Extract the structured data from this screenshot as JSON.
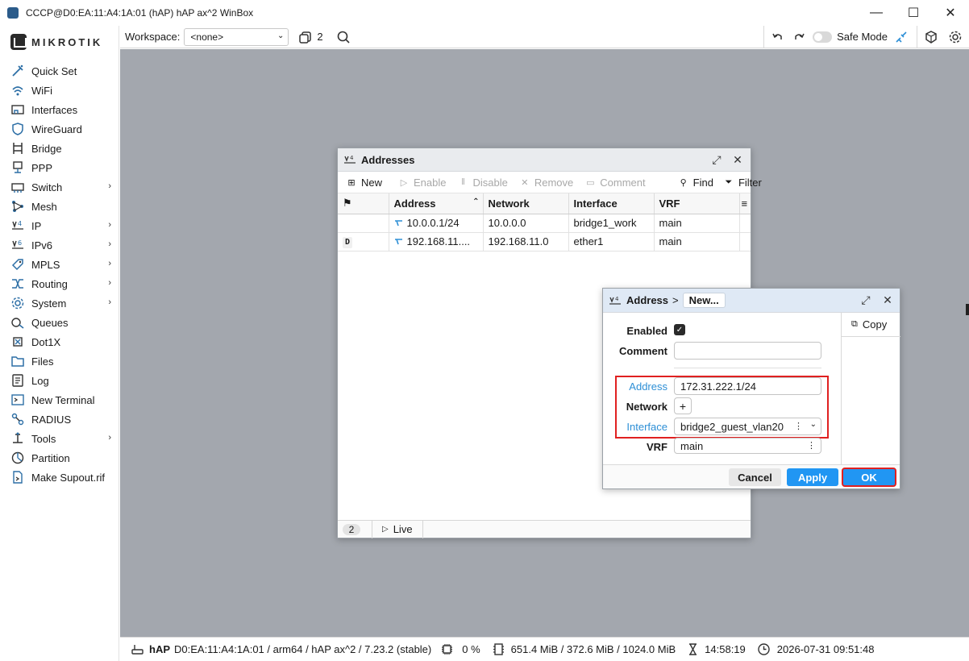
{
  "window": {
    "title": "CCCP@D0:EA:11:A4:1A:01 (hAP) hAP ax^2 WinBox",
    "minimize": "—",
    "maximize": "☐",
    "close": "✕"
  },
  "brand": {
    "logo_text": "MIKROTIK"
  },
  "sidebar": {
    "items": [
      {
        "label": "Quick Set",
        "icon": "quick-set-icon",
        "submenu": false
      },
      {
        "label": "WiFi",
        "icon": "wifi-icon",
        "submenu": false
      },
      {
        "label": "Interfaces",
        "icon": "interfaces-icon",
        "submenu": false
      },
      {
        "label": "WireGuard",
        "icon": "wireguard-icon",
        "submenu": false
      },
      {
        "label": "Bridge",
        "icon": "bridge-icon",
        "submenu": false
      },
      {
        "label": "PPP",
        "icon": "ppp-icon",
        "submenu": false
      },
      {
        "label": "Switch",
        "icon": "switch-icon",
        "submenu": true
      },
      {
        "label": "Mesh",
        "icon": "mesh-icon",
        "submenu": false
      },
      {
        "label": "IP",
        "icon": "ip-icon",
        "submenu": true
      },
      {
        "label": "IPv6",
        "icon": "ipv6-icon",
        "submenu": true
      },
      {
        "label": "MPLS",
        "icon": "mpls-icon",
        "submenu": true
      },
      {
        "label": "Routing",
        "icon": "routing-icon",
        "submenu": true
      },
      {
        "label": "System",
        "icon": "system-icon",
        "submenu": true
      },
      {
        "label": "Queues",
        "icon": "queues-icon",
        "submenu": false
      },
      {
        "label": "Dot1X",
        "icon": "dot1x-icon",
        "submenu": false
      },
      {
        "label": "Files",
        "icon": "files-icon",
        "submenu": false
      },
      {
        "label": "Log",
        "icon": "log-icon",
        "submenu": false
      },
      {
        "label": "New Terminal",
        "icon": "terminal-icon",
        "submenu": false
      },
      {
        "label": "RADIUS",
        "icon": "radius-icon",
        "submenu": false
      },
      {
        "label": "Tools",
        "icon": "tools-icon",
        "submenu": true
      },
      {
        "label": "Partition",
        "icon": "partition-icon",
        "submenu": false
      },
      {
        "label": "Make Supout.rif",
        "icon": "supout-icon",
        "submenu": false
      }
    ],
    "chevron": "›"
  },
  "toolbar": {
    "workspace_label": "Workspace:",
    "workspace_value": "<none>",
    "windows_count": "2",
    "safe_mode_label": "Safe Mode"
  },
  "addresses": {
    "title": "Addresses",
    "tools": {
      "new": "New",
      "enable": "Enable",
      "disable": "Disable",
      "remove": "Remove",
      "comment": "Comment",
      "find": "Find",
      "filter": "Filter"
    },
    "columns": [
      "Address",
      "Network",
      "Interface",
      "VRF"
    ],
    "rows": [
      {
        "flag": "",
        "address": "10.0.0.1/24",
        "network": "10.0.0.0",
        "interface": "bridge1_work",
        "vrf": "main"
      },
      {
        "flag": "D",
        "address": "192.168.11....",
        "network": "192.168.11.0",
        "interface": "ether1",
        "vrf": "main"
      }
    ],
    "footer": {
      "count": "2",
      "live": "Live"
    }
  },
  "dialog": {
    "title": "Address",
    "crumb_sep": ">",
    "crumb": "New...",
    "copy": "Copy",
    "labels": {
      "enabled": "Enabled",
      "comment": "Comment",
      "address": "Address",
      "network": "Network",
      "interface": "Interface",
      "vrf": "VRF"
    },
    "values": {
      "comment": "",
      "address": "172.31.222.1/24",
      "network_add": "+",
      "interface": "bridge2_guest_vlan20",
      "vrf": "main"
    },
    "buttons": {
      "cancel": "Cancel",
      "apply": "Apply",
      "ok": "OK"
    },
    "colors": {
      "primary": "#2196f3",
      "highlight": "#e02020",
      "label_blue": "#2d8fd6"
    }
  },
  "statusbar": {
    "device": "hAP",
    "info": "D0:EA:11:A4:1A:01 / arm64 / hAP ax^2 / 7.23.2 (stable)",
    "cpu": "0 %",
    "memory": "651.4 MiB / 372.6 MiB / 1024.0 MiB",
    "uptime": "14:58:19",
    "datetime": "2026-07-31 09:51:48"
  }
}
